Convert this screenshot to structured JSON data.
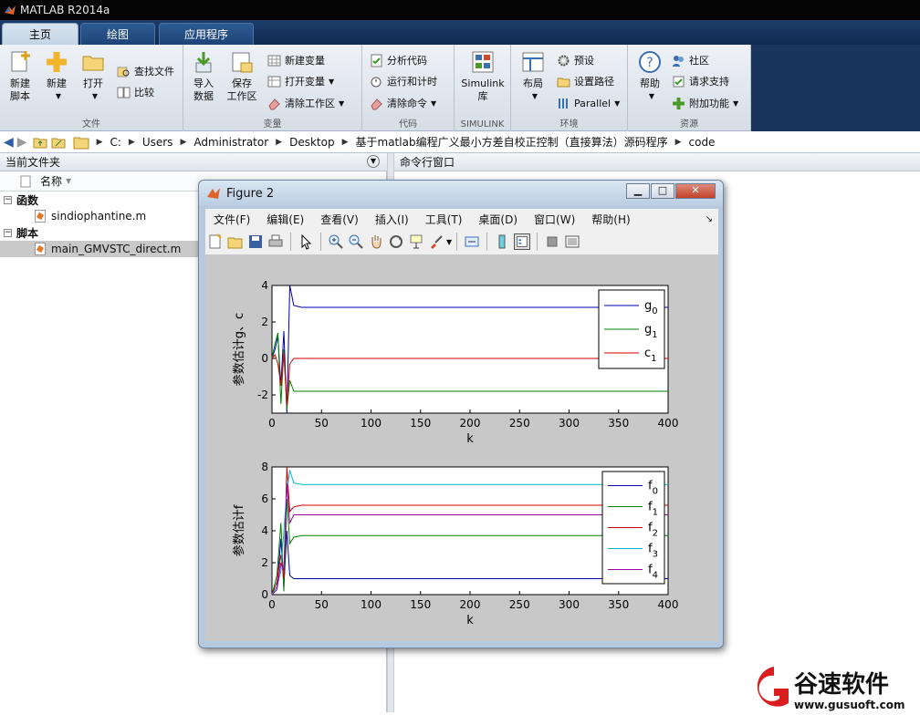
{
  "app": {
    "title": "MATLAB R2014a"
  },
  "ribbon_tabs": [
    "主页",
    "绘图",
    "应用程序"
  ],
  "ribbon": {
    "file_group": {
      "label": "文件",
      "new_script": "新建\n脚本",
      "new": "新建",
      "open": "打开",
      "find_files": "查找文件",
      "compare": "比较"
    },
    "variable_group": {
      "label": "变量",
      "import_data": "导入\n数据",
      "save_workspace": "保存\n工作区",
      "new_variable": "新建变量",
      "open_variable": "打开变量",
      "clear_workspace": "清除工作区"
    },
    "code_group": {
      "label": "代码",
      "analyze_code": "分析代码",
      "run_and_time": "运行和计时",
      "clear_commands": "清除命令"
    },
    "simulink_group": {
      "label": "SIMULINK",
      "simulink_library": "Simulink\n库"
    },
    "env_group": {
      "label": "环境",
      "layout": "布局",
      "preferences": "预设",
      "set_path": "设置路径",
      "parallel": "Parallel"
    },
    "resources_group": {
      "label": "资源",
      "help": "帮助",
      "community": "社区",
      "request_support": "请求支持",
      "add_ons": "附加功能"
    }
  },
  "address": {
    "crumbs": [
      "C:",
      "Users",
      "Administrator",
      "Desktop",
      "基于matlab编程广义最小方差自校正控制（直接算法）源码程序",
      "code"
    ]
  },
  "file_browser": {
    "title": "当前文件夹",
    "column_name": "名称",
    "sections": [
      {
        "label": "函数",
        "files": [
          "sindiophantine.m"
        ]
      },
      {
        "label": "脚本",
        "files": [
          "main_GMVSTC_direct.m"
        ]
      }
    ]
  },
  "command_window": {
    "title": "命令行窗口"
  },
  "figure": {
    "title": "Figure 2",
    "menu": [
      "文件(F)",
      "编辑(E)",
      "查看(V)",
      "插入(I)",
      "工具(T)",
      "桌面(D)",
      "窗口(W)",
      "帮助(H)"
    ]
  },
  "colors": {
    "blue": "#0000b0",
    "green": "#008000",
    "red": "#d00000",
    "cyan": "#00b8c8",
    "magenta": "#a000a0"
  },
  "chart_data": [
    {
      "type": "line",
      "title": "",
      "xlabel": "k",
      "ylabel": "参数估计g、c",
      "xlim": [
        0,
        400
      ],
      "ylim": [
        -3,
        4
      ],
      "xticks": [
        0,
        50,
        100,
        150,
        200,
        250,
        300,
        350,
        400
      ],
      "yticks": [
        -2,
        0,
        2,
        4
      ],
      "legend_position": "top-right",
      "series": [
        {
          "name": "g0",
          "color": "#0000b0",
          "x": [
            0,
            3,
            6,
            9,
            12,
            15,
            18,
            22,
            30,
            100,
            200,
            300,
            400
          ],
          "y": [
            0,
            0.5,
            1.2,
            -1.5,
            1.5,
            -3,
            4,
            2.9,
            2.8,
            2.8,
            2.8,
            2.8,
            2.8
          ]
        },
        {
          "name": "g1",
          "color": "#008000",
          "x": [
            0,
            3,
            6,
            9,
            12,
            15,
            18,
            22,
            30,
            100,
            200,
            300,
            400
          ],
          "y": [
            0,
            0.8,
            1.4,
            -2.5,
            0.5,
            -2.8,
            -1.2,
            -1.8,
            -1.8,
            -1.8,
            -1.8,
            -1.8,
            -1.8
          ]
        },
        {
          "name": "c1",
          "color": "#d00000",
          "x": [
            0,
            3,
            6,
            9,
            12,
            15,
            18,
            22,
            30,
            100,
            200,
            300,
            400
          ],
          "y": [
            0,
            0.2,
            -0.3,
            -1.5,
            0.3,
            -2.6,
            -0.3,
            0,
            0,
            0,
            0,
            0,
            0
          ]
        }
      ]
    },
    {
      "type": "line",
      "title": "",
      "xlabel": "k",
      "ylabel": "参数估计f",
      "xlim": [
        0,
        400
      ],
      "ylim": [
        0,
        8
      ],
      "xticks": [
        0,
        50,
        100,
        150,
        200,
        250,
        300,
        350,
        400
      ],
      "yticks": [
        0,
        2,
        4,
        6,
        8
      ],
      "legend_position": "top-right",
      "series": [
        {
          "name": "f0",
          "color": "#0000b0",
          "x": [
            0,
            5,
            9,
            12,
            15,
            18,
            22,
            30,
            100,
            200,
            300,
            400
          ],
          "y": [
            0,
            0.5,
            3.5,
            0.5,
            4,
            1.2,
            1.0,
            1.0,
            1.0,
            1.0,
            1.0,
            1.0
          ]
        },
        {
          "name": "f1",
          "color": "#008000",
          "x": [
            0,
            5,
            9,
            12,
            15,
            18,
            22,
            30,
            100,
            200,
            300,
            400
          ],
          "y": [
            0,
            1.2,
            4.5,
            0.2,
            6,
            3.2,
            3.6,
            3.7,
            3.7,
            3.7,
            3.7,
            3.7
          ]
        },
        {
          "name": "f2",
          "color": "#d00000",
          "x": [
            0,
            5,
            9,
            12,
            15,
            18,
            22,
            30,
            100,
            200,
            300,
            400
          ],
          "y": [
            0,
            0.8,
            2.5,
            1.0,
            8,
            5.2,
            5.5,
            5.6,
            5.6,
            5.6,
            5.6,
            5.6
          ]
        },
        {
          "name": "f3",
          "color": "#00b8c8",
          "x": [
            0,
            5,
            9,
            12,
            15,
            18,
            22,
            30,
            100,
            200,
            300,
            400
          ],
          "y": [
            0,
            0.5,
            1.5,
            4.0,
            6.5,
            7.8,
            7.0,
            6.9,
            6.9,
            6.9,
            6.9,
            6.9
          ]
        },
        {
          "name": "f4",
          "color": "#a000a0",
          "x": [
            0,
            5,
            9,
            12,
            15,
            18,
            22,
            30,
            100,
            200,
            300,
            400
          ],
          "y": [
            0,
            0.3,
            2.0,
            1.5,
            7,
            4.5,
            5.0,
            5.0,
            5.0,
            5.0,
            5.0,
            5.0
          ]
        }
      ]
    }
  ],
  "watermark": {
    "brand": "谷速软件",
    "url": "www.gusuoft.com"
  }
}
